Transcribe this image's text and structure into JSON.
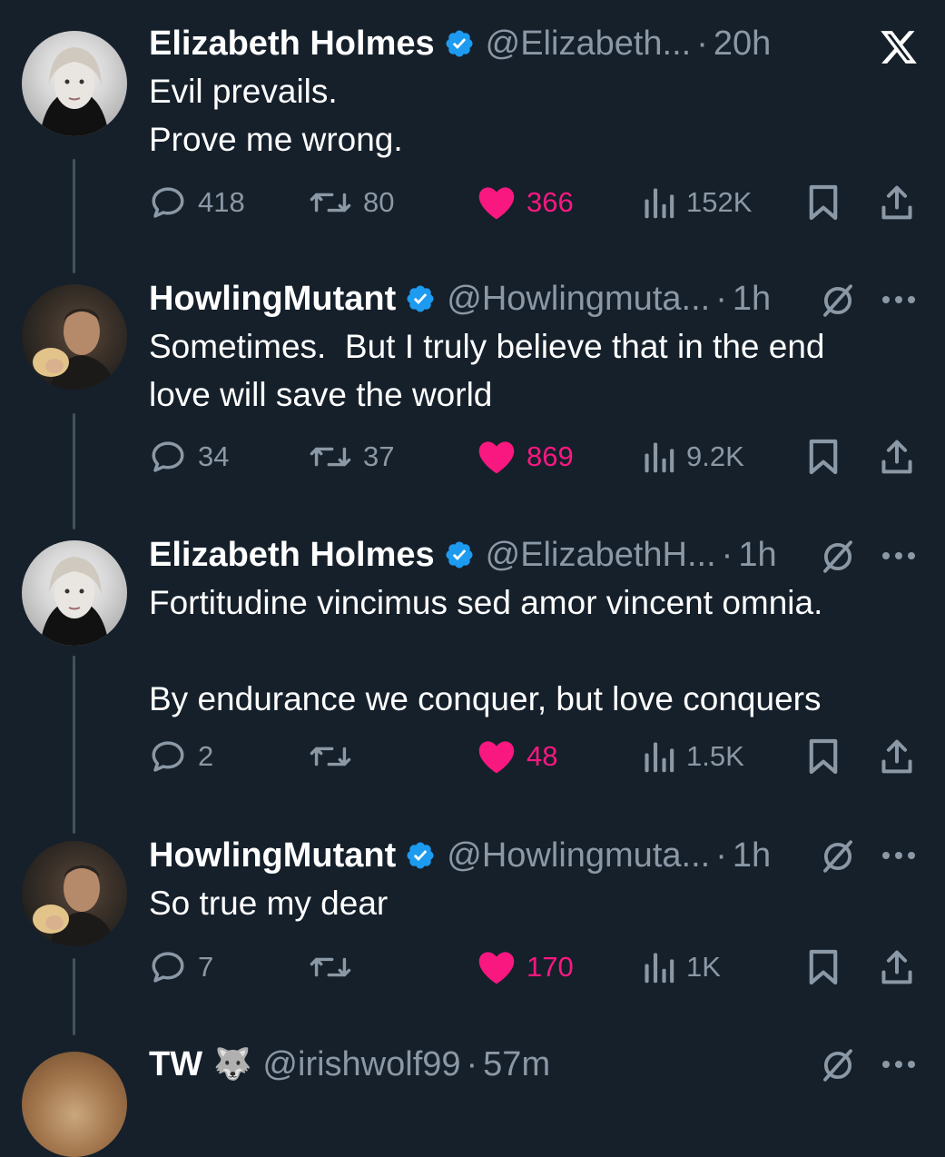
{
  "tweets": [
    {
      "name": "Elizabeth Holmes",
      "handle": "@Elizabeth...",
      "time": "20h",
      "text": "Evil prevails.\nProve me wrong.",
      "replies": "418",
      "reposts": "80",
      "likes": "366",
      "views": "152K",
      "verified": true
    },
    {
      "name": "HowlingMutant",
      "handle": "@Howlingmuta...",
      "time": "1h",
      "text": "Sometimes.  But I truly believe that in the end love will save the world",
      "replies": "34",
      "reposts": "37",
      "likes": "869",
      "views": "9.2K",
      "verified": true
    },
    {
      "name": "Elizabeth Holmes",
      "handle": "@ElizabethH...",
      "time": "1h",
      "text": "Fortitudine vincimus sed amor vincent omnia.\n\nBy endurance we conquer, but love conquers",
      "replies": "2",
      "reposts": "",
      "likes": "48",
      "views": "1.5K",
      "verified": true
    },
    {
      "name": "HowlingMutant",
      "handle": "@Howlingmuta...",
      "time": "1h",
      "text": "So true my dear",
      "replies": "7",
      "reposts": "",
      "likes": "170",
      "views": "1K",
      "verified": true
    },
    {
      "name": "TW",
      "name_emoji": "🐺",
      "handle": "@irishwolf99",
      "time": "57m"
    }
  ],
  "separator": "·",
  "icons": {
    "app_logo": "x-logo-icon",
    "reply": "speech-bubble-icon",
    "repost": "repost-arrows-icon",
    "like": "heart-icon",
    "views": "bar-chart-icon",
    "bookmark": "bookmark-icon",
    "share": "share-upload-icon",
    "muted": "slashed-circle-icon",
    "more": "ellipsis-icon"
  },
  "colors": {
    "background": "#15202b",
    "verified": "#1d9bf0",
    "like": "#f91880",
    "muted_text": "#8b98a5",
    "thread_line": "#42535f"
  }
}
